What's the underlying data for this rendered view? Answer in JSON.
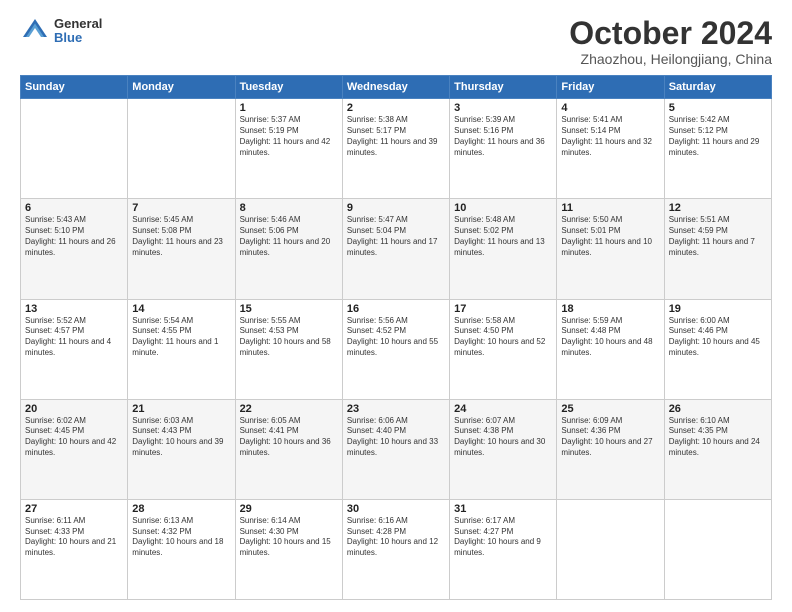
{
  "header": {
    "logo_general": "General",
    "logo_blue": "Blue",
    "month_title": "October 2024",
    "location": "Zhaozhou, Heilongjiang, China"
  },
  "weekdays": [
    "Sunday",
    "Monday",
    "Tuesday",
    "Wednesday",
    "Thursday",
    "Friday",
    "Saturday"
  ],
  "weeks": [
    [
      {
        "day": "",
        "sunrise": "",
        "sunset": "",
        "daylight": ""
      },
      {
        "day": "",
        "sunrise": "",
        "sunset": "",
        "daylight": ""
      },
      {
        "day": "1",
        "sunrise": "Sunrise: 5:37 AM",
        "sunset": "Sunset: 5:19 PM",
        "daylight": "Daylight: 11 hours and 42 minutes."
      },
      {
        "day": "2",
        "sunrise": "Sunrise: 5:38 AM",
        "sunset": "Sunset: 5:17 PM",
        "daylight": "Daylight: 11 hours and 39 minutes."
      },
      {
        "day": "3",
        "sunrise": "Sunrise: 5:39 AM",
        "sunset": "Sunset: 5:16 PM",
        "daylight": "Daylight: 11 hours and 36 minutes."
      },
      {
        "day": "4",
        "sunrise": "Sunrise: 5:41 AM",
        "sunset": "Sunset: 5:14 PM",
        "daylight": "Daylight: 11 hours and 32 minutes."
      },
      {
        "day": "5",
        "sunrise": "Sunrise: 5:42 AM",
        "sunset": "Sunset: 5:12 PM",
        "daylight": "Daylight: 11 hours and 29 minutes."
      }
    ],
    [
      {
        "day": "6",
        "sunrise": "Sunrise: 5:43 AM",
        "sunset": "Sunset: 5:10 PM",
        "daylight": "Daylight: 11 hours and 26 minutes."
      },
      {
        "day": "7",
        "sunrise": "Sunrise: 5:45 AM",
        "sunset": "Sunset: 5:08 PM",
        "daylight": "Daylight: 11 hours and 23 minutes."
      },
      {
        "day": "8",
        "sunrise": "Sunrise: 5:46 AM",
        "sunset": "Sunset: 5:06 PM",
        "daylight": "Daylight: 11 hours and 20 minutes."
      },
      {
        "day": "9",
        "sunrise": "Sunrise: 5:47 AM",
        "sunset": "Sunset: 5:04 PM",
        "daylight": "Daylight: 11 hours and 17 minutes."
      },
      {
        "day": "10",
        "sunrise": "Sunrise: 5:48 AM",
        "sunset": "Sunset: 5:02 PM",
        "daylight": "Daylight: 11 hours and 13 minutes."
      },
      {
        "day": "11",
        "sunrise": "Sunrise: 5:50 AM",
        "sunset": "Sunset: 5:01 PM",
        "daylight": "Daylight: 11 hours and 10 minutes."
      },
      {
        "day": "12",
        "sunrise": "Sunrise: 5:51 AM",
        "sunset": "Sunset: 4:59 PM",
        "daylight": "Daylight: 11 hours and 7 minutes."
      }
    ],
    [
      {
        "day": "13",
        "sunrise": "Sunrise: 5:52 AM",
        "sunset": "Sunset: 4:57 PM",
        "daylight": "Daylight: 11 hours and 4 minutes."
      },
      {
        "day": "14",
        "sunrise": "Sunrise: 5:54 AM",
        "sunset": "Sunset: 4:55 PM",
        "daylight": "Daylight: 11 hours and 1 minute."
      },
      {
        "day": "15",
        "sunrise": "Sunrise: 5:55 AM",
        "sunset": "Sunset: 4:53 PM",
        "daylight": "Daylight: 10 hours and 58 minutes."
      },
      {
        "day": "16",
        "sunrise": "Sunrise: 5:56 AM",
        "sunset": "Sunset: 4:52 PM",
        "daylight": "Daylight: 10 hours and 55 minutes."
      },
      {
        "day": "17",
        "sunrise": "Sunrise: 5:58 AM",
        "sunset": "Sunset: 4:50 PM",
        "daylight": "Daylight: 10 hours and 52 minutes."
      },
      {
        "day": "18",
        "sunrise": "Sunrise: 5:59 AM",
        "sunset": "Sunset: 4:48 PM",
        "daylight": "Daylight: 10 hours and 48 minutes."
      },
      {
        "day": "19",
        "sunrise": "Sunrise: 6:00 AM",
        "sunset": "Sunset: 4:46 PM",
        "daylight": "Daylight: 10 hours and 45 minutes."
      }
    ],
    [
      {
        "day": "20",
        "sunrise": "Sunrise: 6:02 AM",
        "sunset": "Sunset: 4:45 PM",
        "daylight": "Daylight: 10 hours and 42 minutes."
      },
      {
        "day": "21",
        "sunrise": "Sunrise: 6:03 AM",
        "sunset": "Sunset: 4:43 PM",
        "daylight": "Daylight: 10 hours and 39 minutes."
      },
      {
        "day": "22",
        "sunrise": "Sunrise: 6:05 AM",
        "sunset": "Sunset: 4:41 PM",
        "daylight": "Daylight: 10 hours and 36 minutes."
      },
      {
        "day": "23",
        "sunrise": "Sunrise: 6:06 AM",
        "sunset": "Sunset: 4:40 PM",
        "daylight": "Daylight: 10 hours and 33 minutes."
      },
      {
        "day": "24",
        "sunrise": "Sunrise: 6:07 AM",
        "sunset": "Sunset: 4:38 PM",
        "daylight": "Daylight: 10 hours and 30 minutes."
      },
      {
        "day": "25",
        "sunrise": "Sunrise: 6:09 AM",
        "sunset": "Sunset: 4:36 PM",
        "daylight": "Daylight: 10 hours and 27 minutes."
      },
      {
        "day": "26",
        "sunrise": "Sunrise: 6:10 AM",
        "sunset": "Sunset: 4:35 PM",
        "daylight": "Daylight: 10 hours and 24 minutes."
      }
    ],
    [
      {
        "day": "27",
        "sunrise": "Sunrise: 6:11 AM",
        "sunset": "Sunset: 4:33 PM",
        "daylight": "Daylight: 10 hours and 21 minutes."
      },
      {
        "day": "28",
        "sunrise": "Sunrise: 6:13 AM",
        "sunset": "Sunset: 4:32 PM",
        "daylight": "Daylight: 10 hours and 18 minutes."
      },
      {
        "day": "29",
        "sunrise": "Sunrise: 6:14 AM",
        "sunset": "Sunset: 4:30 PM",
        "daylight": "Daylight: 10 hours and 15 minutes."
      },
      {
        "day": "30",
        "sunrise": "Sunrise: 6:16 AM",
        "sunset": "Sunset: 4:28 PM",
        "daylight": "Daylight: 10 hours and 12 minutes."
      },
      {
        "day": "31",
        "sunrise": "Sunrise: 6:17 AM",
        "sunset": "Sunset: 4:27 PM",
        "daylight": "Daylight: 10 hours and 9 minutes."
      },
      {
        "day": "",
        "sunrise": "",
        "sunset": "",
        "daylight": ""
      },
      {
        "day": "",
        "sunrise": "",
        "sunset": "",
        "daylight": ""
      }
    ]
  ]
}
